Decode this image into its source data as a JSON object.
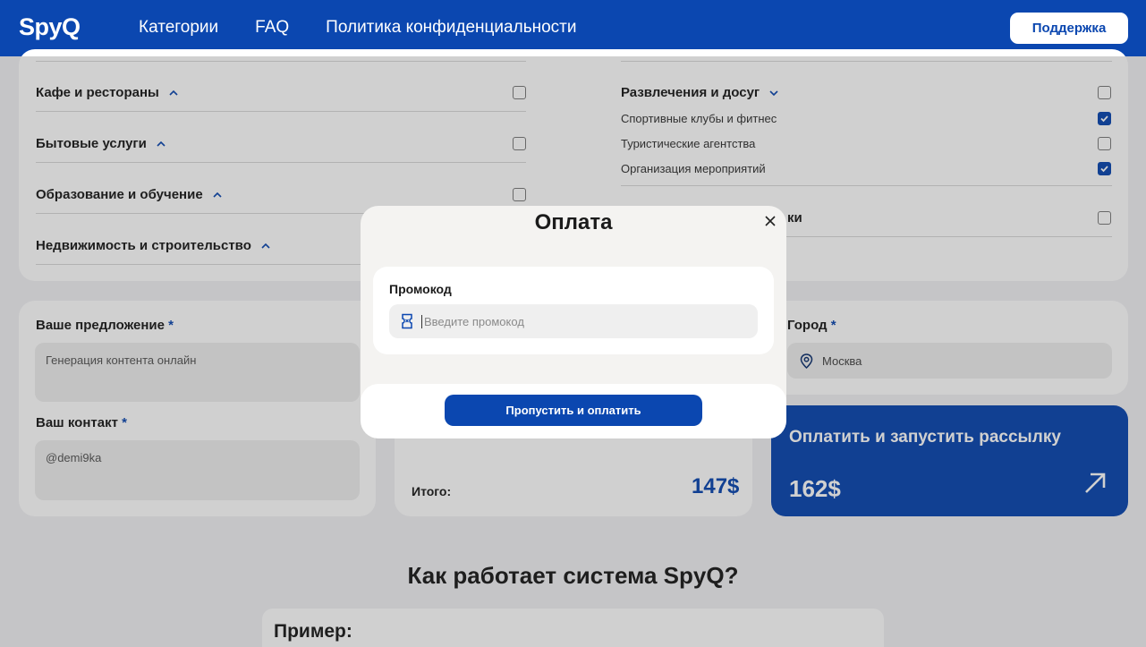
{
  "header": {
    "logo": "SpyQ",
    "nav": [
      "Категории",
      "FAQ",
      "Политика конфиденциальности"
    ],
    "support_label": "Поддержка"
  },
  "categories_left": [
    {
      "label": "Кафе и рестораны",
      "checked": false
    },
    {
      "label": "Бытовые услуги",
      "checked": false
    },
    {
      "label": "Образование и обучение",
      "checked": false
    },
    {
      "label": "Недвижимость и строительство",
      "checked": false
    }
  ],
  "categories_right": {
    "group_label": "Развлечения и досуг",
    "group_checked": false,
    "items": [
      {
        "label": "Спортивные клубы и фитнес",
        "checked": true
      },
      {
        "label": "Туристические агентства",
        "checked": false
      },
      {
        "label": "Организация мероприятий",
        "checked": true
      }
    ],
    "partial_label": "ки",
    "partial_checked": false
  },
  "form": {
    "offer_label": "Ваше предложение",
    "offer_value": "Генерация контента онлайн",
    "contact_label": "Ваш контакт",
    "contact_value": "@demi9ka",
    "required_mark": "*",
    "city_label": "Город",
    "city_value": "Москва"
  },
  "total": {
    "label": "Итого:",
    "value": "147$"
  },
  "pay_card": {
    "title": "Оплатить и запустить рассылку",
    "price": "162$"
  },
  "how": {
    "title": "Как работает система SpyQ?",
    "example": "Пример:"
  },
  "modal": {
    "title": "Оплата",
    "promo_label": "Промокод",
    "promo_placeholder": "Введите промокод",
    "promo_value": "",
    "skip_button": "Пропустить и оплатить"
  },
  "colors": {
    "brand": "#0b47b0",
    "background": "#f1f1f4"
  }
}
